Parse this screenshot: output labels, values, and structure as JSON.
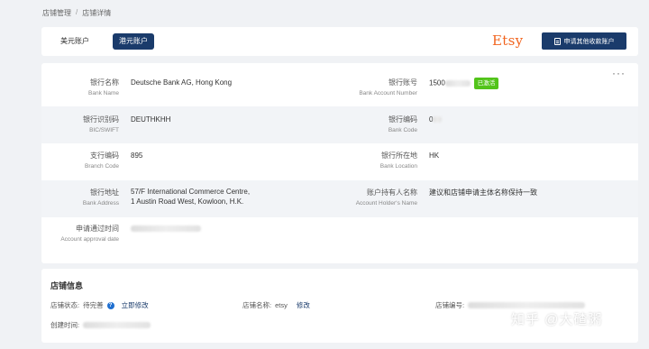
{
  "breadcrumb": {
    "parent": "店铺管理",
    "separator": "/",
    "current": "店铺详情"
  },
  "tabs": [
    {
      "label": "美元账户",
      "active": false
    },
    {
      "label": "港元账户",
      "active": true
    }
  ],
  "brand": {
    "logo_text": "Etsy",
    "logo_color": "#f1641e"
  },
  "apply_button": {
    "label": "申请其他收款账户"
  },
  "bank_info": {
    "bank_name": {
      "label_cn": "银行名称",
      "label_en": "Bank Name",
      "value": "Deutsche Bank AG, Hong Kong"
    },
    "bank_account_number": {
      "label_cn": "银行账号",
      "label_en": "Bank Account Number",
      "value": "1500",
      "status": "已激活"
    },
    "bic_swift": {
      "label_cn": "银行识别码",
      "label_en": "BIC/SWIFT",
      "value": "DEUTHKHH"
    },
    "bank_code": {
      "label_cn": "银行编码",
      "label_en": "Bank Code",
      "value": "0"
    },
    "branch_code": {
      "label_cn": "支行编码",
      "label_en": "Branch Code",
      "value": "895"
    },
    "bank_location": {
      "label_cn": "银行所在地",
      "label_en": "Bank Location",
      "value": "HK"
    },
    "bank_address": {
      "label_cn": "银行地址",
      "label_en": "Bank Address",
      "value_line1": "57/F International Commerce Centre,",
      "value_line2": "1 Austin Road West, Kowloon, H.K."
    },
    "account_holder": {
      "label_cn": "账户持有人名称",
      "label_en": "Account Holder‘s Name",
      "value": "建议和店铺申请主体名称保持一致"
    },
    "approval_date": {
      "label_cn": "申请通过时间",
      "label_en": "Account approval date"
    }
  },
  "shop_info": {
    "title": "店铺信息",
    "status_label": "店铺状态:",
    "status_value": "待完善",
    "fix_now": "立即修改",
    "name_label": "店铺名称:",
    "name_value": "etsy",
    "edit": "修改",
    "number_label": "店铺编号:",
    "created_label": "创建时间:"
  },
  "watermark": "知乎 @大碴粥",
  "colors": {
    "primary": "#1a3b6b",
    "success": "#52c41a",
    "help": "#1f6fd0"
  }
}
